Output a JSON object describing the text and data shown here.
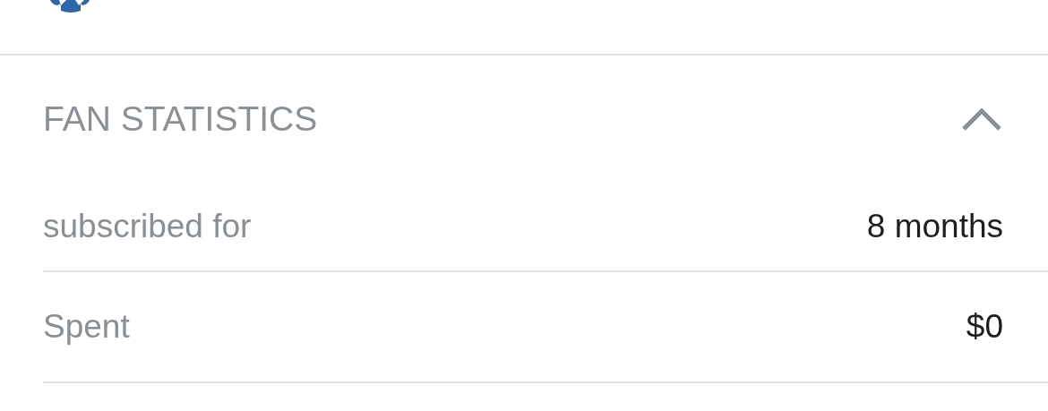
{
  "section": {
    "title": "FAN STATISTICS",
    "expanded": true,
    "rows": [
      {
        "label": "subscribed for",
        "value": "8 months"
      },
      {
        "label": "Spent",
        "value": "$0"
      }
    ]
  }
}
